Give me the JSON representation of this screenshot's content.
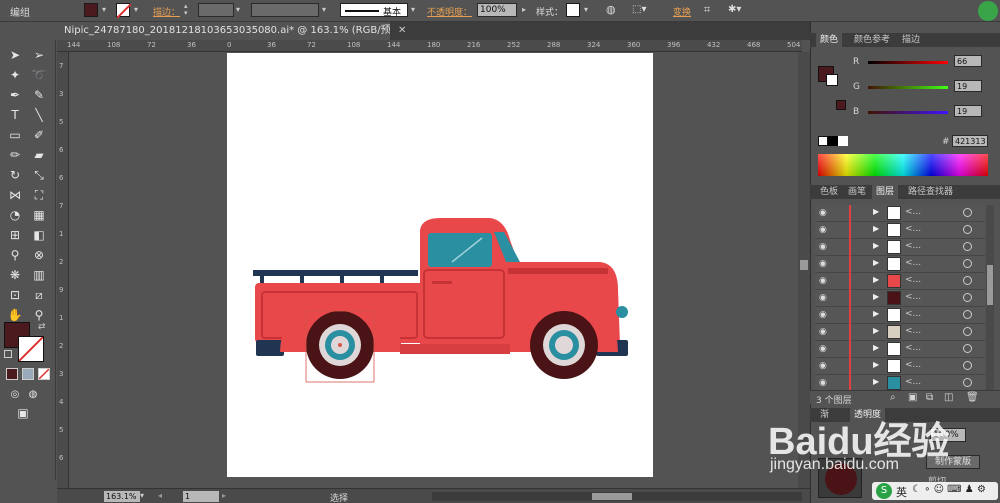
{
  "menu": {
    "group_label": "编组"
  },
  "control_bar": {
    "fill_color": "#4a1a1e",
    "stroke_label": "描边：",
    "stroke_style": "基本",
    "opacity_label": "不透明度：",
    "opacity_value": "100%",
    "style_label": "样式：",
    "transform_label": "变换"
  },
  "document": {
    "tab_title": "Nipic_24787180_20181218103653035080.ai* @ 163.1% (RGB/预览)",
    "zoom": "163.1%",
    "page": "1",
    "status": "选择"
  },
  "rulers": {
    "h_ticks": [
      "144",
      "108",
      "72",
      "36",
      "0",
      "36",
      "72",
      "108",
      "144",
      "180",
      "216",
      "252",
      "288",
      "324",
      "360",
      "396",
      "432",
      "468",
      "504"
    ],
    "v_ticks": [
      "7",
      "3",
      "5",
      "6",
      "6",
      "7",
      "1",
      "2",
      "9",
      "1",
      "2",
      "3",
      "4",
      "5",
      "6"
    ]
  },
  "color_panel": {
    "tabs": [
      "颜色",
      "颜色参考",
      "描边"
    ],
    "r_label": "R",
    "r_value": "66",
    "g_label": "G",
    "g_value": "19",
    "b_label": "B",
    "b_value": "19",
    "hex_label": "#",
    "hex_value": "421313"
  },
  "layers_panel": {
    "tabs": [
      "色板",
      "画笔",
      "图层",
      "路径查找器"
    ],
    "footer_text": "3 个图层",
    "row_label": "<...",
    "rows": 11
  },
  "bottom_panel": {
    "tabs": [
      "渐",
      "透明度"
    ],
    "opacity_value": "100%",
    "make_mask": "制作蒙版",
    "clip": "剪切"
  },
  "watermark": {
    "brand": "Baidu经验",
    "url": "jingyan.baidu.com"
  },
  "colors": {
    "truck_red": "#e8484a",
    "truck_dark_red": "#c73236",
    "navy": "#1f3552",
    "teal": "#2a8fa0",
    "tire": "#4a1417",
    "fill_swatch": "#4a1a1e"
  }
}
